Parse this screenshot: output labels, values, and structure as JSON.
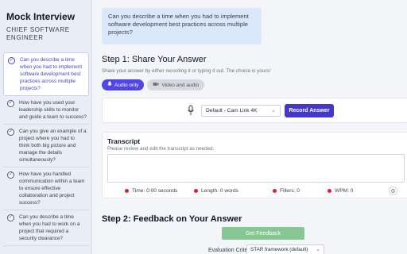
{
  "sidebar": {
    "title": "Mock Interview",
    "role": "CHIEF SOFTWARE ENGINEER",
    "questions": [
      {
        "text": "Can you describe a time when you had to implement software development best practices across multiple projects?",
        "active": true
      },
      {
        "text": "How have you used your leadership skills to monitor and guide a team to success?",
        "active": false
      },
      {
        "text": "Can you give an example of a project where you had to think both big picture and manage the details simultaneously?",
        "active": false
      },
      {
        "text": "How have you handled communication within a team to ensure effective collaboration and project success?",
        "active": false
      },
      {
        "text": "Can you describe a time when you had to work on a project that required a security clearance?",
        "active": false
      }
    ]
  },
  "main": {
    "question": "Can you describe a time when you had to implement software development best practices across multiple projects?",
    "step1": {
      "title": "Step 1: Share Your Answer",
      "subtitle": "Share your answer by either recording it or typing it out. The choice is yours!",
      "modes": [
        {
          "label": "Audio only",
          "icon": "microphone-icon",
          "active": true
        },
        {
          "label": "Video and audio",
          "icon": "video-icon",
          "active": false
        }
      ],
      "device_select": "Default - Cam Link 4K",
      "record_button": "Record Answer"
    },
    "transcript": {
      "title": "Transcript",
      "subtitle": "Please review and edit the transcript as needed.",
      "stats": {
        "time": "Time: 0:00 seconds",
        "length": "Length: 0 words",
        "fillers": "Fillers: 0",
        "wpm": "WPM: 0"
      }
    },
    "step2": {
      "title": "Step 2: Feedback on Your Answer",
      "feedback_button": "Get Feedback",
      "criteria_label": "Evaluation Criteria:",
      "criteria_value": "STAR framework (default)"
    }
  },
  "colors": {
    "accent": "#4338ca",
    "question_bg": "#dbe7fb",
    "feedback_button": "#86c793",
    "stat_dot": "#e11d2e"
  }
}
